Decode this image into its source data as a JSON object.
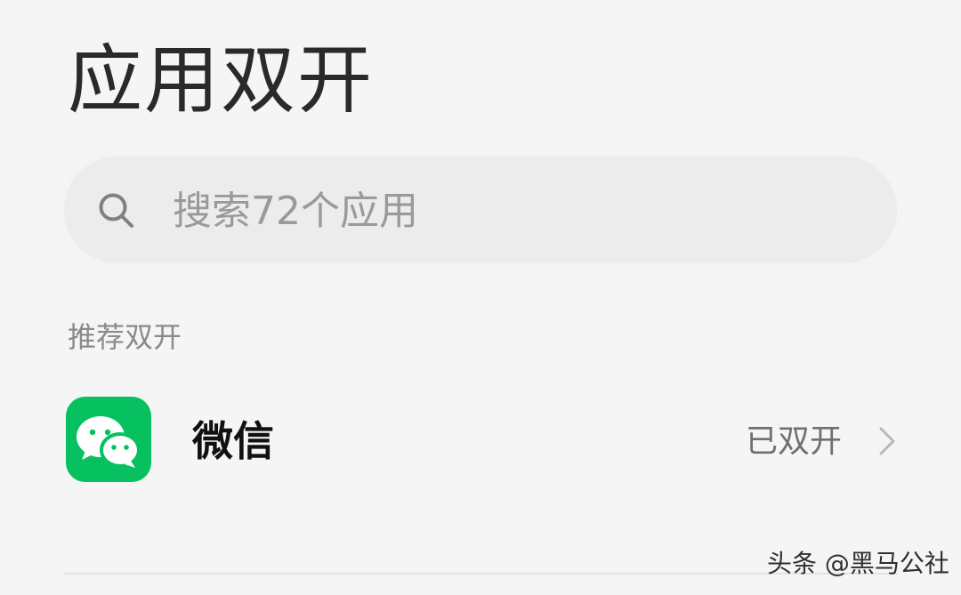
{
  "header": {
    "title": "应用双开"
  },
  "search": {
    "placeholder": "搜索72个应用",
    "icon": "search-icon"
  },
  "section": {
    "title": "推荐双开"
  },
  "apps": [
    {
      "name": "微信",
      "status": "已双开",
      "icon": "wechat-icon",
      "icon_color": "#07C160"
    }
  ],
  "watermark": {
    "text": "头条 @黑马公社"
  }
}
